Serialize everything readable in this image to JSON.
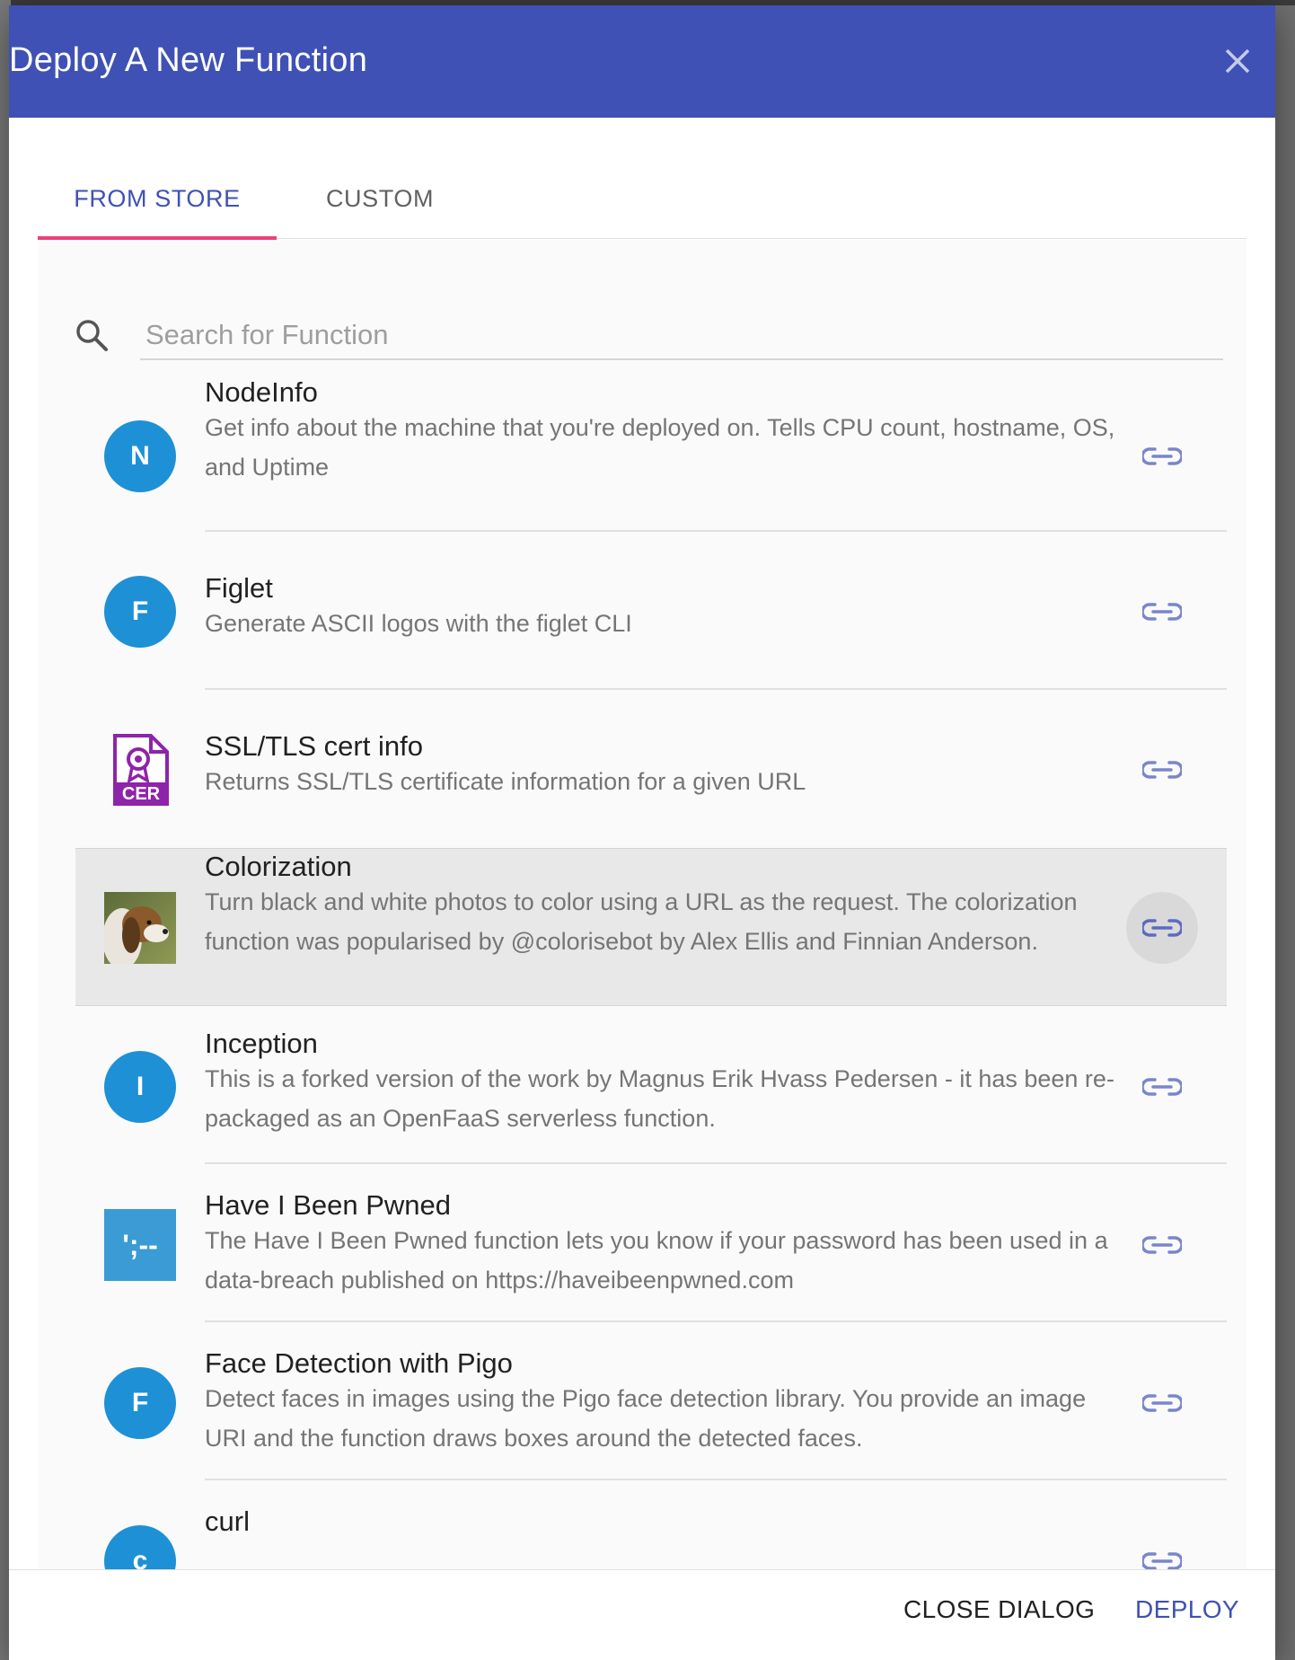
{
  "dialog": {
    "title": "Deploy A New Function",
    "close_icon": "close-icon"
  },
  "tabs": [
    {
      "label": "FROM STORE",
      "active": true
    },
    {
      "label": "CUSTOM",
      "active": false
    }
  ],
  "search": {
    "placeholder": "Search for Function",
    "value": "",
    "icon": "search-icon"
  },
  "functions": [
    {
      "name": "NodeInfo",
      "avatar": "N",
      "avatar_type": "letter",
      "description": "Get info about the machine that you're deployed on. Tells CPU count, hostname, OS, and Uptime",
      "link_icon": "link-icon"
    },
    {
      "name": "Figlet",
      "avatar": "F",
      "avatar_type": "letter",
      "description": "Generate ASCII logos with the figlet CLI",
      "link_icon": "link-icon"
    },
    {
      "name": "SSL/TLS cert info",
      "avatar": "CER",
      "avatar_type": "certificate-icon",
      "description": "Returns SSL/TLS certificate information for a given URL",
      "link_icon": "link-icon"
    },
    {
      "name": "Colorization",
      "avatar": "",
      "avatar_type": "dog-photo",
      "description": "Turn black and white photos to color using a URL as the request. The colorization function was popularised by @colorisebot by Alex Ellis and Finnian Anderson.",
      "link_icon": "link-icon",
      "highlighted": true
    },
    {
      "name": "Inception",
      "avatar": "I",
      "avatar_type": "letter",
      "description": "This is a forked version of the work by Magnus Erik Hvass Pedersen - it has been re-packaged as an OpenFaaS serverless function.",
      "link_icon": "link-icon"
    },
    {
      "name": "Have I Been Pwned",
      "avatar": "';--",
      "avatar_type": "hibp-logo",
      "description": "The Have I Been Pwned function lets you know if your password has been used in a data-breach published on https://haveibeenpwned.com",
      "link_icon": "link-icon"
    },
    {
      "name": "Face Detection with Pigo",
      "avatar": "F",
      "avatar_type": "letter",
      "description": "Detect faces in images using the Pigo face detection library. You provide an image URI and the function draws boxes around the detected faces.",
      "link_icon": "link-icon"
    },
    {
      "name": "curl",
      "avatar": "c",
      "avatar_type": "letter",
      "description": "",
      "link_icon": "link-icon"
    }
  ],
  "footer": {
    "close_label": "CLOSE DIALOG",
    "deploy_label": "DEPLOY"
  },
  "colors": {
    "header": "#3f51b5",
    "accent": "#3f51b5",
    "tab_indicator": "#ec407a",
    "avatar": "#1e90d6",
    "certificate": "#8e24aa",
    "hibp": "#3a9bd5"
  }
}
